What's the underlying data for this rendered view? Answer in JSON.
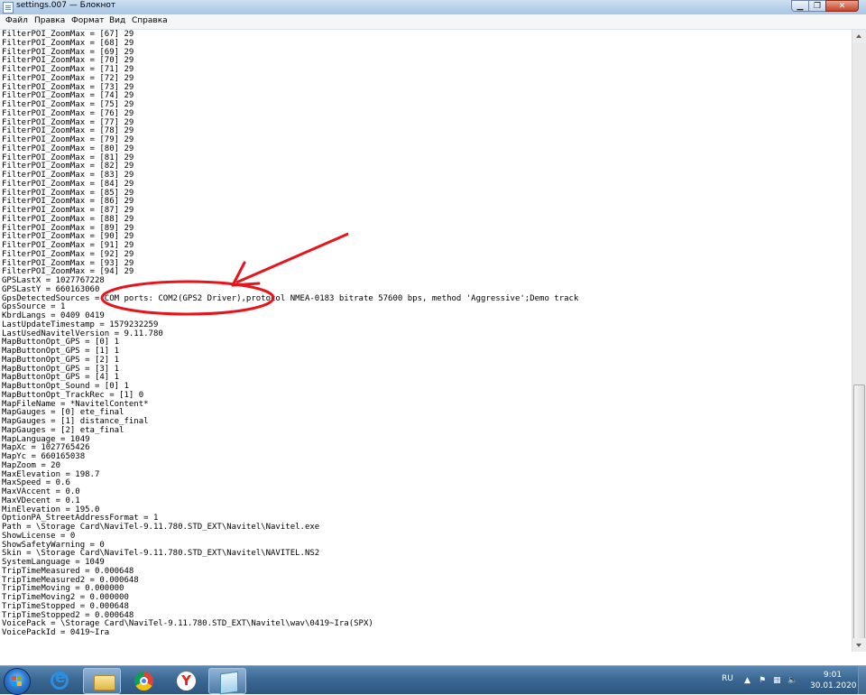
{
  "window": {
    "title": "settings.007 — Блокнот",
    "minimize_glyph": "▁",
    "maximize_glyph": "❐",
    "close_glyph": "✕"
  },
  "menu": [
    "Файл",
    "Правка",
    "Формат",
    "Вид",
    "Справка"
  ],
  "lines": [
    "FilterPOI_ZoomMax = [67] 29",
    "FilterPOI_ZoomMax = [68] 29",
    "FilterPOI_ZoomMax = [69] 29",
    "FilterPOI_ZoomMax = [70] 29",
    "FilterPOI_ZoomMax = [71] 29",
    "FilterPOI_ZoomMax = [72] 29",
    "FilterPOI_ZoomMax = [73] 29",
    "FilterPOI_ZoomMax = [74] 29",
    "FilterPOI_ZoomMax = [75] 29",
    "FilterPOI_ZoomMax = [76] 29",
    "FilterPOI_ZoomMax = [77] 29",
    "FilterPOI_ZoomMax = [78] 29",
    "FilterPOI_ZoomMax = [79] 29",
    "FilterPOI_ZoomMax = [80] 29",
    "FilterPOI_ZoomMax = [81] 29",
    "FilterPOI_ZoomMax = [82] 29",
    "FilterPOI_ZoomMax = [83] 29",
    "FilterPOI_ZoomMax = [84] 29",
    "FilterPOI_ZoomMax = [85] 29",
    "FilterPOI_ZoomMax = [86] 29",
    "FilterPOI_ZoomMax = [87] 29",
    "FilterPOI_ZoomMax = [88] 29",
    "FilterPOI_ZoomMax = [89] 29",
    "FilterPOI_ZoomMax = [90] 29",
    "FilterPOI_ZoomMax = [91] 29",
    "FilterPOI_ZoomMax = [92] 29",
    "FilterPOI_ZoomMax = [93] 29",
    "FilterPOI_ZoomMax = [94] 29",
    "GPSLastX = 1027767228",
    "GPSLastY = 660163060",
    "GpsDetectedSources = COM ports: COM2(GPS2 Driver),protocol NMEA-0183 bitrate 57600 bps, method 'Aggressive';Demo track",
    "GpsSource = 1",
    "KbrdLangs = 0409 0419",
    "LastUpdateTimestamp = 1579232259",
    "LastUsedNavitelVersion = 9.11.780",
    "MapButtonOpt_GPS = [0] 1",
    "MapButtonOpt_GPS = [1] 1",
    "MapButtonOpt_GPS = [2] 1",
    "MapButtonOpt_GPS = [3] 1",
    "MapButtonOpt_GPS = [4] 1",
    "MapButtonOpt_Sound = [0] 1",
    "MapButtonOpt_TrackRec = [1] 0",
    "MapFileName = *NavitelContent*",
    "MapGauges = [0] ete_final",
    "MapGauges = [1] distance_final",
    "MapGauges = [2] eta_final",
    "MapLanguage = 1049",
    "MapXc = 1027765426",
    "MapYc = 660165038",
    "MapZoom = 20",
    "MaxElevation = 198.7",
    "MaxSpeed = 0.6",
    "MaxVAccent = 0.0",
    "MaxVDecent = 0.1",
    "MinElevation = 195.0",
    "OptionPA_StreetAddressFormat = 1",
    "Path = \\Storage Card\\NaviTel-9.11.780.STD_EXT\\Navitel\\Navitel.exe",
    "ShowLicense = 0",
    "ShowSafetyWarning = 0",
    "Skin = \\Storage Card\\NaviTel-9.11.780.STD_EXT\\Navitel\\NAVITEL.NS2",
    "SystemLanguage = 1049",
    "TripTimeMeasured = 0.000648",
    "TripTimeMeasured2 = 0.000648",
    "TripTimeMoving = 0.000000",
    "TripTimeMoving2 = 0.000000",
    "TripTimeStopped = 0.000648",
    "TripTimeStopped2 = 0.000648",
    "VoicePack = \\Storage Card\\NaviTel-9.11.780.STD_EXT\\Navitel\\wav\\0419~Ira(SPX)",
    "VoicePackId = 0419~Ira"
  ],
  "annotation": {
    "color": "#e8141b"
  },
  "taskbar": {
    "apps": [
      "start",
      "internet-explorer",
      "file-explorer",
      "chrome",
      "yandex-browser",
      "notepad"
    ],
    "yandex_letter": "Y",
    "language": "RU",
    "time": "9:01",
    "date": "30.01.2020"
  }
}
